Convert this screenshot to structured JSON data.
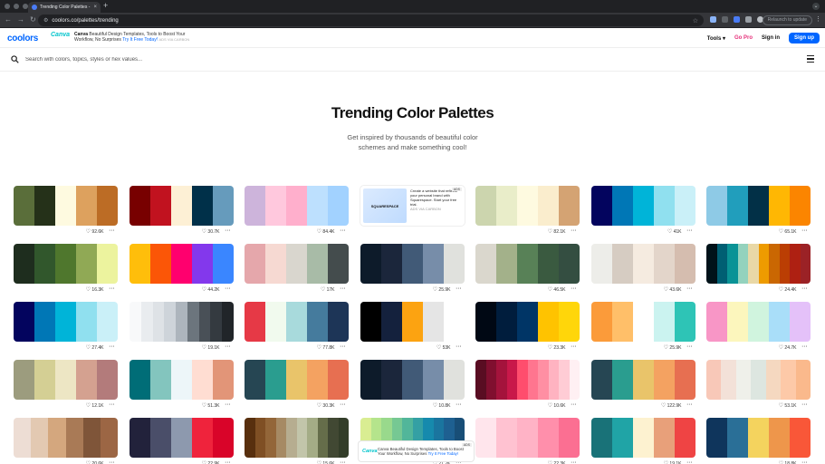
{
  "browser": {
    "tab_title": "Trending Color Palettes - Co...",
    "tab_close": "×",
    "new_tab": "+",
    "url": "coolors.co/palettes/trending",
    "relaunch": "Relaunch to update",
    "back": "←",
    "forward": "→",
    "reload": "↻"
  },
  "header": {
    "logo": "coolors",
    "ad": {
      "brand": "Canva",
      "text_bold": "Canva",
      "text": "Beautiful Design Templates, Tools to Boost Your Workflow, No Surprises",
      "cta": "Try It Free Today!",
      "tag": "ADS VIA CARBON"
    },
    "tools": "Tools ▾",
    "gopro": "Go Pro",
    "signin": "Sign in",
    "signup": "Sign up"
  },
  "search": {
    "placeholder": "Search with colors, topics, styles or hex values..."
  },
  "main": {
    "title": "Trending Color Palettes",
    "subtitle": "Get inspired by thousands of beautiful color schemes and make something cool!"
  },
  "ad_card": {
    "thumb": "SQUARESPACE",
    "text": "Create a website that reflects your personal brand with Squarespace. Start your free trial.",
    "via": "ADS VIA CARBON",
    "badge": "ADS"
  },
  "float_ad": {
    "brand": "Canva",
    "text": "Canva Beautiful Design Templates, Tools to Boost Your Workflow, No Surprises",
    "cta": "Try It Free Today!",
    "close": "ADS"
  },
  "palettes": [
    {
      "colors": [
        "#5a6e3a",
        "#253119",
        "#fefae0",
        "#dda15e",
        "#bc6c25"
      ],
      "likes": "92.6K"
    },
    {
      "colors": [
        "#780000",
        "#c1121f",
        "#fdf0d5",
        "#003049",
        "#669bbc"
      ],
      "likes": "30.7K"
    },
    {
      "colors": [
        "#cdb4db",
        "#ffc8dd",
        "#ffafcc",
        "#bde0fe",
        "#a2d2ff"
      ],
      "likes": "84.4K"
    },
    null,
    {
      "colors": [
        "#ccd5ae",
        "#e9edc9",
        "#fefae0",
        "#faedcd",
        "#d4a373"
      ],
      "likes": "82.1K"
    },
    {
      "colors": [
        "#03045e",
        "#0077b6",
        "#00b4d8",
        "#90e0ef",
        "#caf0f8"
      ],
      "likes": "41K"
    },
    {
      "colors": [
        "#8ecae6",
        "#219ebc",
        "#023047",
        "#ffb703",
        "#fb8500"
      ],
      "likes": "65.1K"
    },
    {
      "colors": [
        "#1e2d1e",
        "#31572c",
        "#4f772d",
        "#90a955",
        "#ecf39e"
      ],
      "likes": "16.3K"
    },
    {
      "colors": [
        "#ffbe0b",
        "#fb5607",
        "#ff006e",
        "#8338ec",
        "#3a86ff"
      ],
      "likes": "44.2K"
    },
    {
      "colors": [
        "#e5a7ab",
        "#f6d9d2",
        "#d9d6ce",
        "#a8bba7",
        "#444c4d"
      ],
      "likes": "17K"
    },
    {
      "colors": [
        "#0d1b2a",
        "#1b263b",
        "#415a77",
        "#778da9",
        "#e0e1dd"
      ],
      "likes": "25.9K"
    },
    {
      "colors": [
        "#dad7cd",
        "#a3b18a",
        "#588157",
        "#3a5a40",
        "#344e41"
      ],
      "likes": "46.5K"
    },
    {
      "colors": [
        "#edede9",
        "#d6ccc2",
        "#f5ebe0",
        "#e3d5ca",
        "#d5bdaf"
      ],
      "likes": "43.6K"
    },
    {
      "colors": [
        "#001219",
        "#005f73",
        "#0a9396",
        "#94d2bd",
        "#e9d8a6",
        "#ee9b00",
        "#ca6702",
        "#bb3e03",
        "#ae2012",
        "#9b2226"
      ],
      "likes": "24.4K"
    },
    {
      "colors": [
        "#03045e",
        "#0077b6",
        "#00b4d8",
        "#90e0ef",
        "#caf0f8"
      ],
      "likes": "27.4K"
    },
    {
      "colors": [
        "#f8f9fa",
        "#e9ecef",
        "#dee2e6",
        "#ced4da",
        "#adb5bd",
        "#6c757d",
        "#495057",
        "#343a40",
        "#212529"
      ],
      "likes": "19.1K"
    },
    {
      "colors": [
        "#e63946",
        "#f1faee",
        "#a8dadc",
        "#457b9d",
        "#1d3557"
      ],
      "likes": "77.8K"
    },
    {
      "colors": [
        "#000000",
        "#14213d",
        "#fca311",
        "#e5e5e5",
        "#ffffff"
      ],
      "likes": "53K"
    },
    {
      "colors": [
        "#000814",
        "#001d3d",
        "#003566",
        "#ffc300",
        "#ffd60a"
      ],
      "likes": "23.3K"
    },
    {
      "colors": [
        "#fb9b3a",
        "#ffbf69",
        "#ffffff",
        "#cbf3f0",
        "#2ec4b6"
      ],
      "likes": "25.9K"
    },
    {
      "colors": [
        "#f896c6",
        "#fcf6bd",
        "#d0f4de",
        "#a9def9",
        "#e4c1f9"
      ],
      "likes": "24.7K"
    },
    {
      "colors": [
        "#9c9c7e",
        "#d4cf94",
        "#ede6c4",
        "#d4a190",
        "#b37b7b"
      ],
      "likes": "12.1K"
    },
    {
      "colors": [
        "#006d77",
        "#83c5be",
        "#edf6f9",
        "#ffddd2",
        "#e29578"
      ],
      "likes": "51.3K"
    },
    {
      "colors": [
        "#264653",
        "#2a9d8f",
        "#e9c46a",
        "#f4a261",
        "#e76f51"
      ],
      "likes": "30.3K"
    },
    {
      "colors": [
        "#0d1b2a",
        "#1b263b",
        "#415a77",
        "#778da9",
        "#e0e1dd"
      ],
      "likes": "10.8K"
    },
    {
      "colors": [
        "#590d22",
        "#800f2f",
        "#a4133c",
        "#c9184a",
        "#ff4d6d",
        "#ff758f",
        "#ff8fa3",
        "#ffb3c1",
        "#ffccd5",
        "#fff0f3"
      ],
      "likes": "10.6K"
    },
    {
      "colors": [
        "#264653",
        "#2a9d8f",
        "#e9c46a",
        "#f4a261",
        "#e76f51"
      ],
      "likes": "122.9K"
    },
    {
      "colors": [
        "#f8c8b8",
        "#f3e1d8",
        "#eff0ea",
        "#dde6e0",
        "#f5d8c0",
        "#fdc9a8",
        "#fab98c"
      ],
      "likes": "53.1K"
    },
    {
      "colors": [
        "#edddd4",
        "#e3c9b2",
        "#d4a77e",
        "#a97a56",
        "#7f5539",
        "#9c6644"
      ],
      "likes": "20.6K"
    },
    {
      "colors": [
        "#22223b",
        "#4a4e69",
        "#8d99ae",
        "#ef233c",
        "#d90429"
      ],
      "likes": "22.9K"
    },
    {
      "colors": [
        "#582f0e",
        "#7f4f24",
        "#936639",
        "#a68a64",
        "#b6ad90",
        "#c2c5aa",
        "#a4ac86",
        "#656d4a",
        "#414833",
        "#333d29"
      ],
      "likes": "15.6K"
    },
    {
      "colors": [
        "#d9ed92",
        "#b5e48c",
        "#99d98c",
        "#76c893",
        "#52b69a",
        "#34a0a4",
        "#168aad",
        "#1a759f",
        "#1e6091",
        "#184e77"
      ],
      "likes": "21.2K"
    },
    {
      "colors": [
        "#ffe5ec",
        "#ffc2d1",
        "#ffb3c6",
        "#ff8fab",
        "#fb6f92"
      ],
      "likes": "22.3K"
    },
    {
      "colors": [
        "#197278",
        "#20a4a6",
        "#fdf2d0",
        "#e8a07a",
        "#ef4444"
      ],
      "likes": "19.1K"
    },
    {
      "colors": [
        "#0f355c",
        "#2a6f97",
        "#f4d35e",
        "#ee964b",
        "#f95738"
      ],
      "likes": "18.8K"
    }
  ]
}
